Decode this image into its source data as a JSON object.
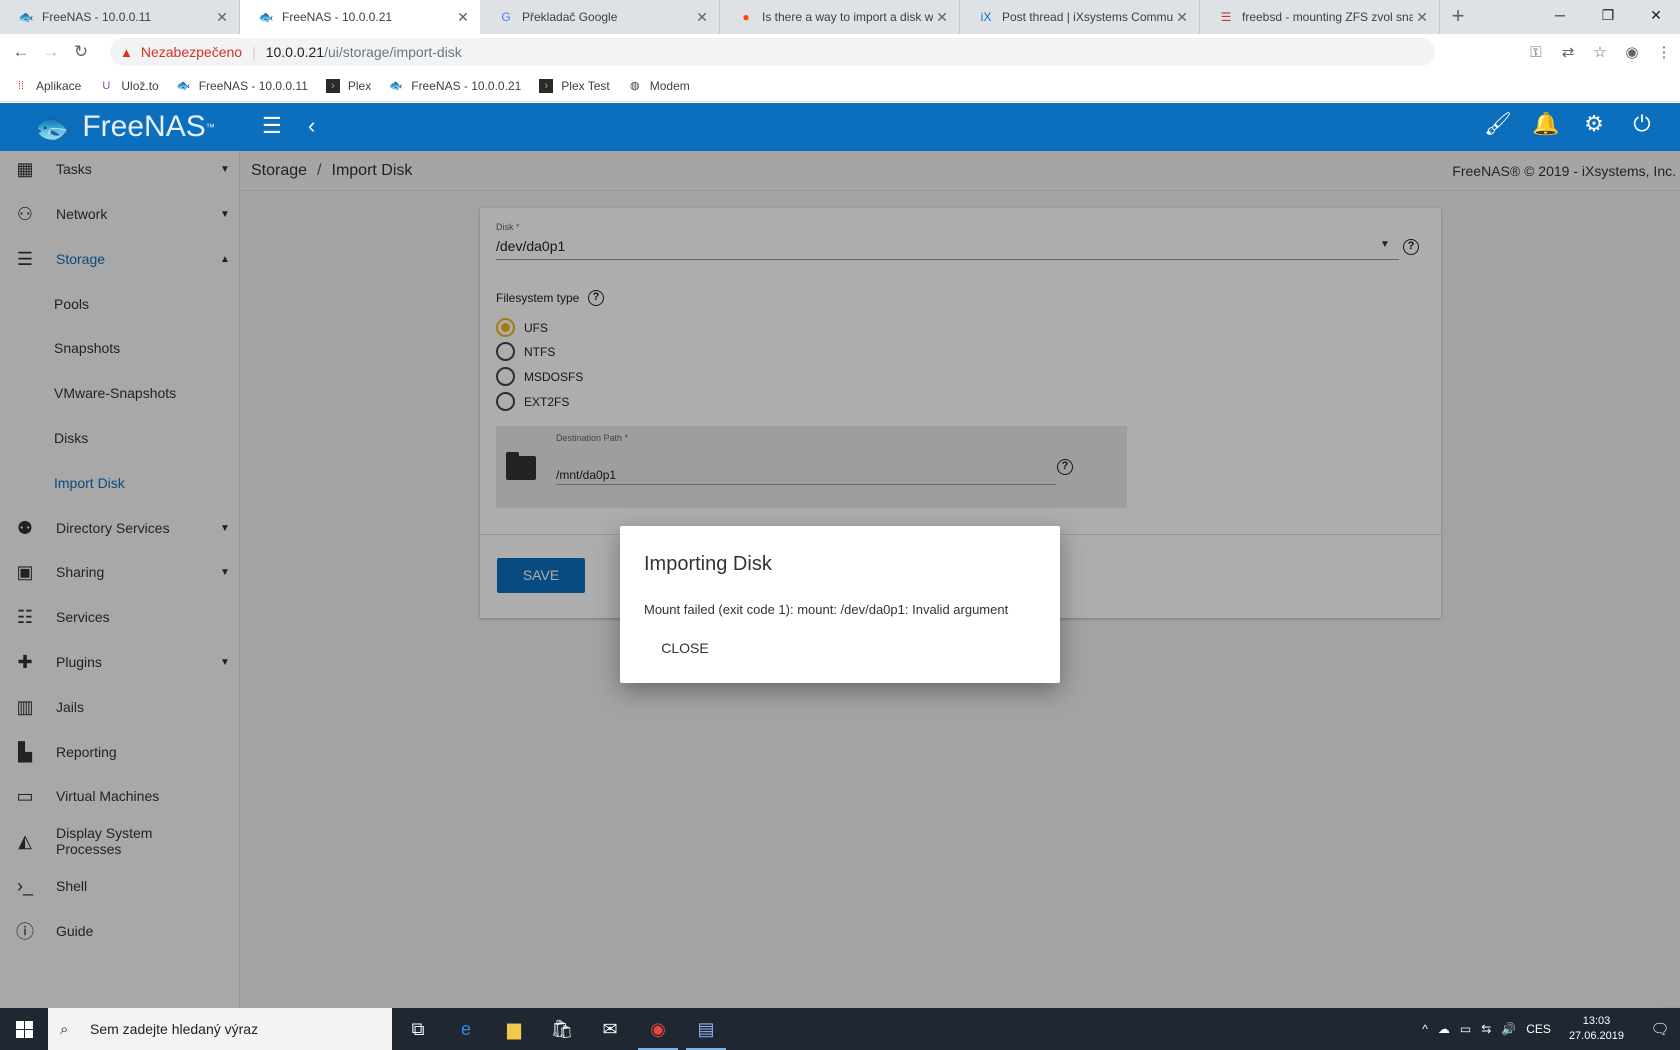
{
  "browser": {
    "tabs": [
      {
        "title": "FreeNAS - 10.0.0.11",
        "icon": "freenas-icon",
        "active": false
      },
      {
        "title": "FreeNAS - 10.0.0.21",
        "icon": "freenas-icon",
        "active": true
      },
      {
        "title": "Překladač Google",
        "icon": "google-translate-icon",
        "active": false
      },
      {
        "title": "Is there a way to import a disk wi",
        "icon": "reddit-icon",
        "active": false
      },
      {
        "title": "Post thread | iXsystems Communi",
        "icon": "ixsystems-icon",
        "active": false
      },
      {
        "title": "freebsd - mounting ZFS zvol snap",
        "icon": "stackexchange-icon",
        "active": false
      }
    ],
    "new_tab": "+",
    "address": {
      "security_label": "Nezabezpečeno",
      "host": "10.0.0.21",
      "path": "/ui/storage/import-disk"
    },
    "bookmarks": [
      {
        "label": "Aplikace",
        "icon": "apps-grid-icon"
      },
      {
        "label": "Ulož.to",
        "icon": "uloz-to-icon"
      },
      {
        "label": "FreeNAS - 10.0.0.11",
        "icon": "freenas-icon"
      },
      {
        "label": "Plex",
        "icon": "plex-icon"
      },
      {
        "label": "FreeNAS - 10.0.0.21",
        "icon": "freenas-icon"
      },
      {
        "label": "Plex Test",
        "icon": "plex-icon"
      },
      {
        "label": "Modem",
        "icon": "globe-icon"
      }
    ]
  },
  "app": {
    "logo_text": "FreeNAS",
    "logo_tm": "™",
    "sidebar": [
      {
        "label": "Tasks",
        "icon": "calendar-icon",
        "caret": "▼",
        "sub": false
      },
      {
        "label": "Network",
        "icon": "network-icon",
        "caret": "▼",
        "sub": false
      },
      {
        "label": "Storage",
        "icon": "storage-icon",
        "caret": "▲",
        "sub": false,
        "selected": true
      },
      {
        "label": "Pools",
        "sub": true
      },
      {
        "label": "Snapshots",
        "sub": true
      },
      {
        "label": "VMware-Snapshots",
        "sub": true
      },
      {
        "label": "Disks",
        "sub": true
      },
      {
        "label": "Import Disk",
        "sub": true,
        "selected": true
      },
      {
        "label": "Directory Services",
        "icon": "directory-icon",
        "caret": "▼",
        "sub": false
      },
      {
        "label": "Sharing",
        "icon": "sharing-icon",
        "caret": "▼",
        "sub": false
      },
      {
        "label": "Services",
        "icon": "tune-icon",
        "caret": "",
        "sub": false
      },
      {
        "label": "Plugins",
        "icon": "puzzle-icon",
        "caret": "▼",
        "sub": false
      },
      {
        "label": "Jails",
        "icon": "jail-icon",
        "caret": "",
        "sub": false
      },
      {
        "label": "Reporting",
        "icon": "chart-icon",
        "caret": "",
        "sub": false
      },
      {
        "label": "Virtual Machines",
        "icon": "laptop-icon",
        "caret": "",
        "sub": false
      },
      {
        "label": "Display System Processes",
        "icon": "processes-icon",
        "caret": "",
        "sub": false
      },
      {
        "label": "Shell",
        "icon": "terminal-icon",
        "caret": "",
        "sub": false
      },
      {
        "label": "Guide",
        "icon": "info-icon",
        "caret": "",
        "sub": false
      }
    ],
    "breadcrumb": {
      "parent": "Storage",
      "current": "Import Disk"
    },
    "copyright": "FreeNAS® © 2019 - iXsystems, Inc.",
    "form": {
      "disk_label": "Disk *",
      "disk_value": "/dev/da0p1",
      "fs_label": "Filesystem type",
      "fs_options": [
        "UFS",
        "NTFS",
        "MSDOSFS",
        "EXT2FS"
      ],
      "fs_selected": "UFS",
      "dest_label": "Destination Path *",
      "dest_value": "/mnt/da0p1",
      "save_label": "SAVE"
    },
    "dialog": {
      "title": "Importing Disk",
      "message": "Mount failed (exit code 1): mount: /dev/da0p1: Invalid argument",
      "close_label": "CLOSE"
    }
  },
  "taskbar": {
    "search_placeholder": "Sem zadejte hledaný výraz",
    "language": "CES",
    "time": "13:03",
    "date": "27.06.2019"
  }
}
